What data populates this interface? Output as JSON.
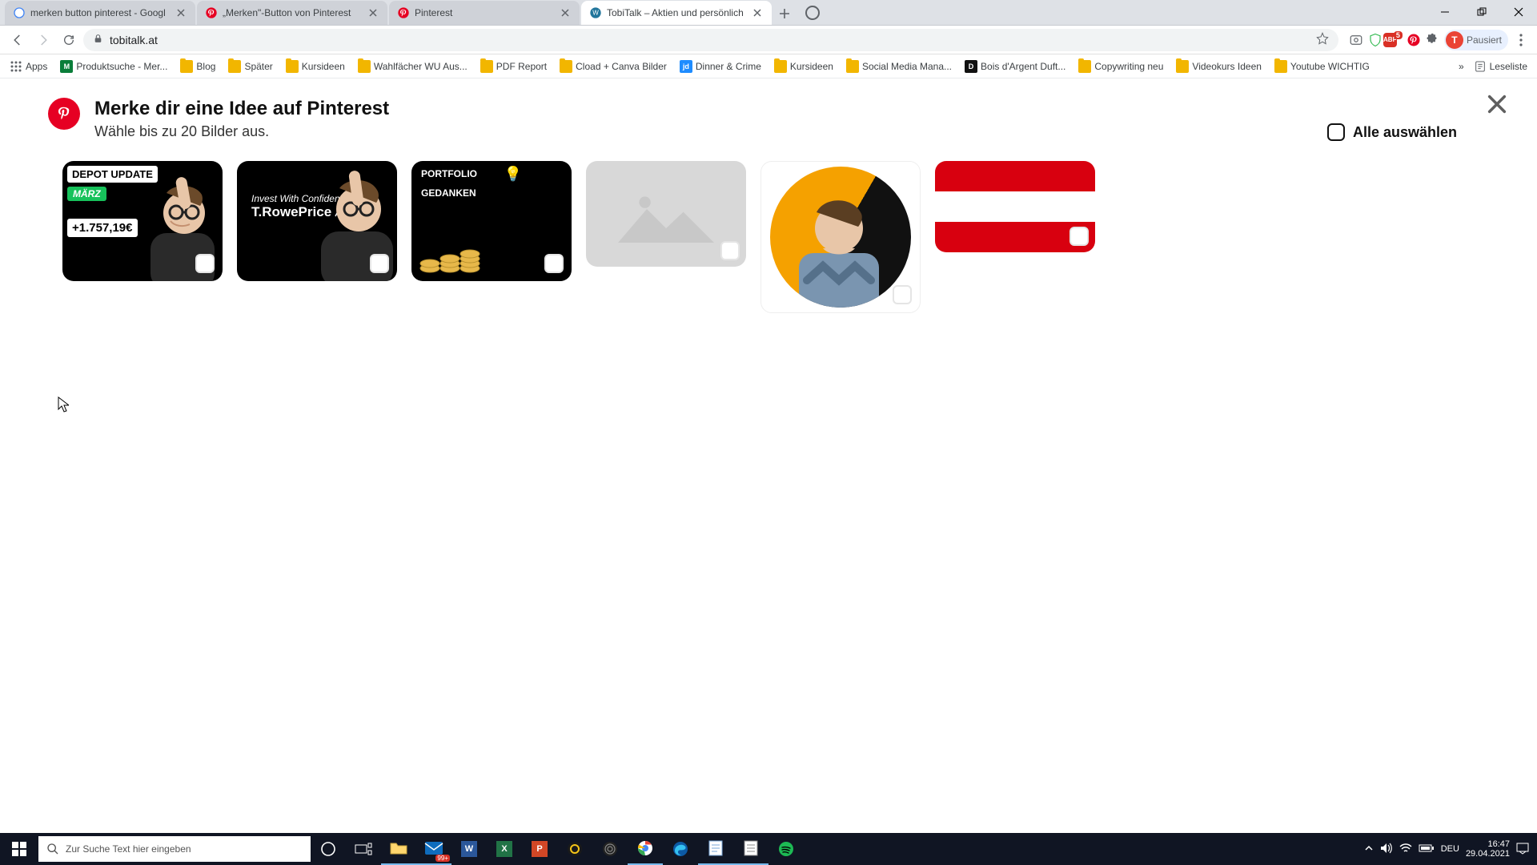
{
  "browser": {
    "tabs": [
      {
        "title": "merken button pinterest - Googl",
        "favicon": "google"
      },
      {
        "title": "„Merken\"-Button von Pinterest",
        "favicon": "pinterest"
      },
      {
        "title": "Pinterest",
        "favicon": "pinterest"
      },
      {
        "title": "TobiTalk – Aktien und persönlich",
        "favicon": "wordpress",
        "active": true
      }
    ],
    "url": "tobitalk.at",
    "profile_status": "Pausiert",
    "profile_letter": "T"
  },
  "bookmarks_bar": {
    "apps_label": "Apps",
    "items": [
      {
        "label": "Produktsuche - Mer...",
        "icon": "green"
      },
      {
        "label": "Blog",
        "icon": "folder"
      },
      {
        "label": "Später",
        "icon": "folder"
      },
      {
        "label": "Kursideen",
        "icon": "folder"
      },
      {
        "label": "Wahlfächer WU Aus...",
        "icon": "folder"
      },
      {
        "label": "PDF Report",
        "icon": "folder"
      },
      {
        "label": "Cload + Canva Bilder",
        "icon": "folder"
      },
      {
        "label": "Dinner & Crime",
        "icon": "jd"
      },
      {
        "label": "Kursideen",
        "icon": "folder"
      },
      {
        "label": "Social Media Mana...",
        "icon": "folder"
      },
      {
        "label": "Bois d'Argent Duft...",
        "icon": "dark"
      },
      {
        "label": "Copywriting neu",
        "icon": "folder"
      },
      {
        "label": "Videokurs Ideen",
        "icon": "folder"
      },
      {
        "label": "Youtube WICHTIG",
        "icon": "folder"
      }
    ],
    "reading_list": "Leseliste"
  },
  "pinterest_save": {
    "heading": "Merke dir eine Idee auf Pinterest",
    "subheading": "Wähle bis zu 20 Bilder aus.",
    "select_all_label": "Alle auswählen",
    "thumbs": {
      "t1_top": "DEPOT UPDATE",
      "t1_mid": "MÄRZ",
      "t1_bot": "+1.757,19€",
      "t2_brand_top": "Invest With Confidence",
      "t2_brand_main": "T.RowePrice",
      "t3_top": "PORTFOLIO",
      "t3_bot": "GEDANKEN"
    },
    "flag_colors": {
      "top": "#d8000f",
      "mid": "#ffffff",
      "bot": "#d8000f"
    }
  },
  "taskbar": {
    "search_placeholder": "Zur Suche Text hier eingeben",
    "lang": "DEU",
    "time": "16:47",
    "date": "29.04.2021",
    "badge": "99+"
  }
}
